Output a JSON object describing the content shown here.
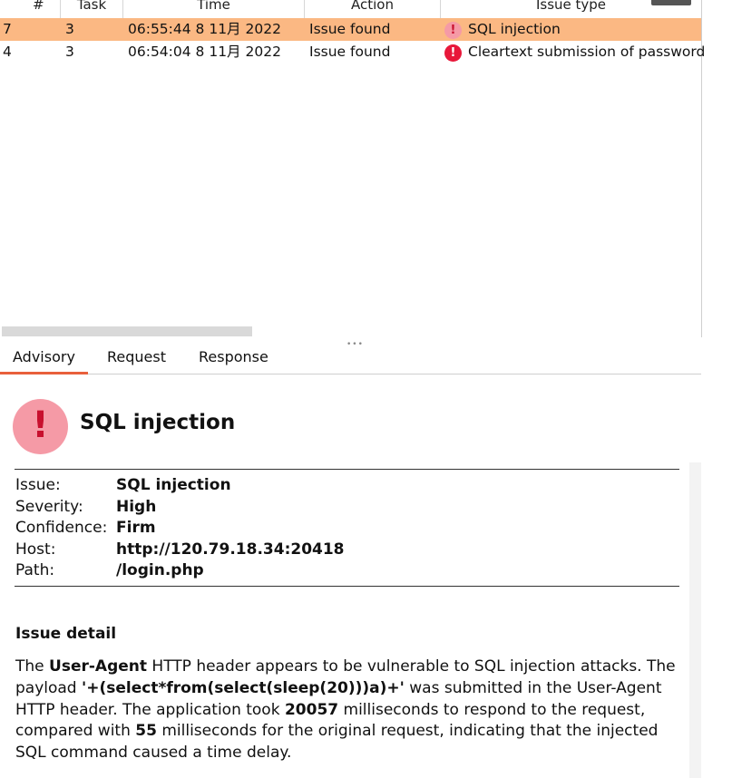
{
  "table": {
    "columns": [
      {
        "label": "#",
        "name": "col-number"
      },
      {
        "label": "Task",
        "name": "col-task"
      },
      {
        "label": "Time",
        "name": "col-time"
      },
      {
        "label": "Action",
        "name": "col-action"
      },
      {
        "label": "Issue type",
        "name": "col-issue-type"
      }
    ],
    "rows": [
      {
        "num": "7",
        "task": "3",
        "time": "06:55:44 8 11月 2022",
        "action": "Issue found",
        "issue_type": "SQL injection",
        "icon": "severity-high-selected-icon"
      },
      {
        "num": "4",
        "task": "3",
        "time": "06:54:04 8 11月 2022",
        "action": "Issue found",
        "issue_type": "Cleartext submission of password",
        "icon": "severity-high-icon"
      }
    ]
  },
  "tabs": [
    "Advisory",
    "Request",
    "Response"
  ],
  "advisory": {
    "title": "SQL injection",
    "fields": [
      {
        "label": "Issue:",
        "value": "SQL injection"
      },
      {
        "label": "Severity:",
        "value": "High"
      },
      {
        "label": "Confidence:",
        "value": "Firm"
      },
      {
        "label": "Host:",
        "value": "http://120.79.18.34:20418"
      },
      {
        "label": "Path:",
        "value": "/login.php"
      }
    ],
    "detail_heading": "Issue detail",
    "detail": {
      "p1": "The ",
      "b1": "User-Agent",
      "p2": " HTTP header appears to be vulnerable to SQL injection attacks. The payload ",
      "b2": "'+(select*from(select(sleep(20)))a)+'",
      "p3": " was submitted in the User-Agent HTTP header. The application took ",
      "b3": "20057",
      "p4": " milliseconds to respond to the request, compared with ",
      "b4": "55",
      "p5": " milliseconds for the original request, indicating that the injected SQL command caused a time delay."
    }
  },
  "colors": {
    "selected_row": "#fbb883",
    "severity_high": "#e8183a",
    "severity_high_light": "#f59aa6",
    "tab_accent": "#e8603c"
  }
}
